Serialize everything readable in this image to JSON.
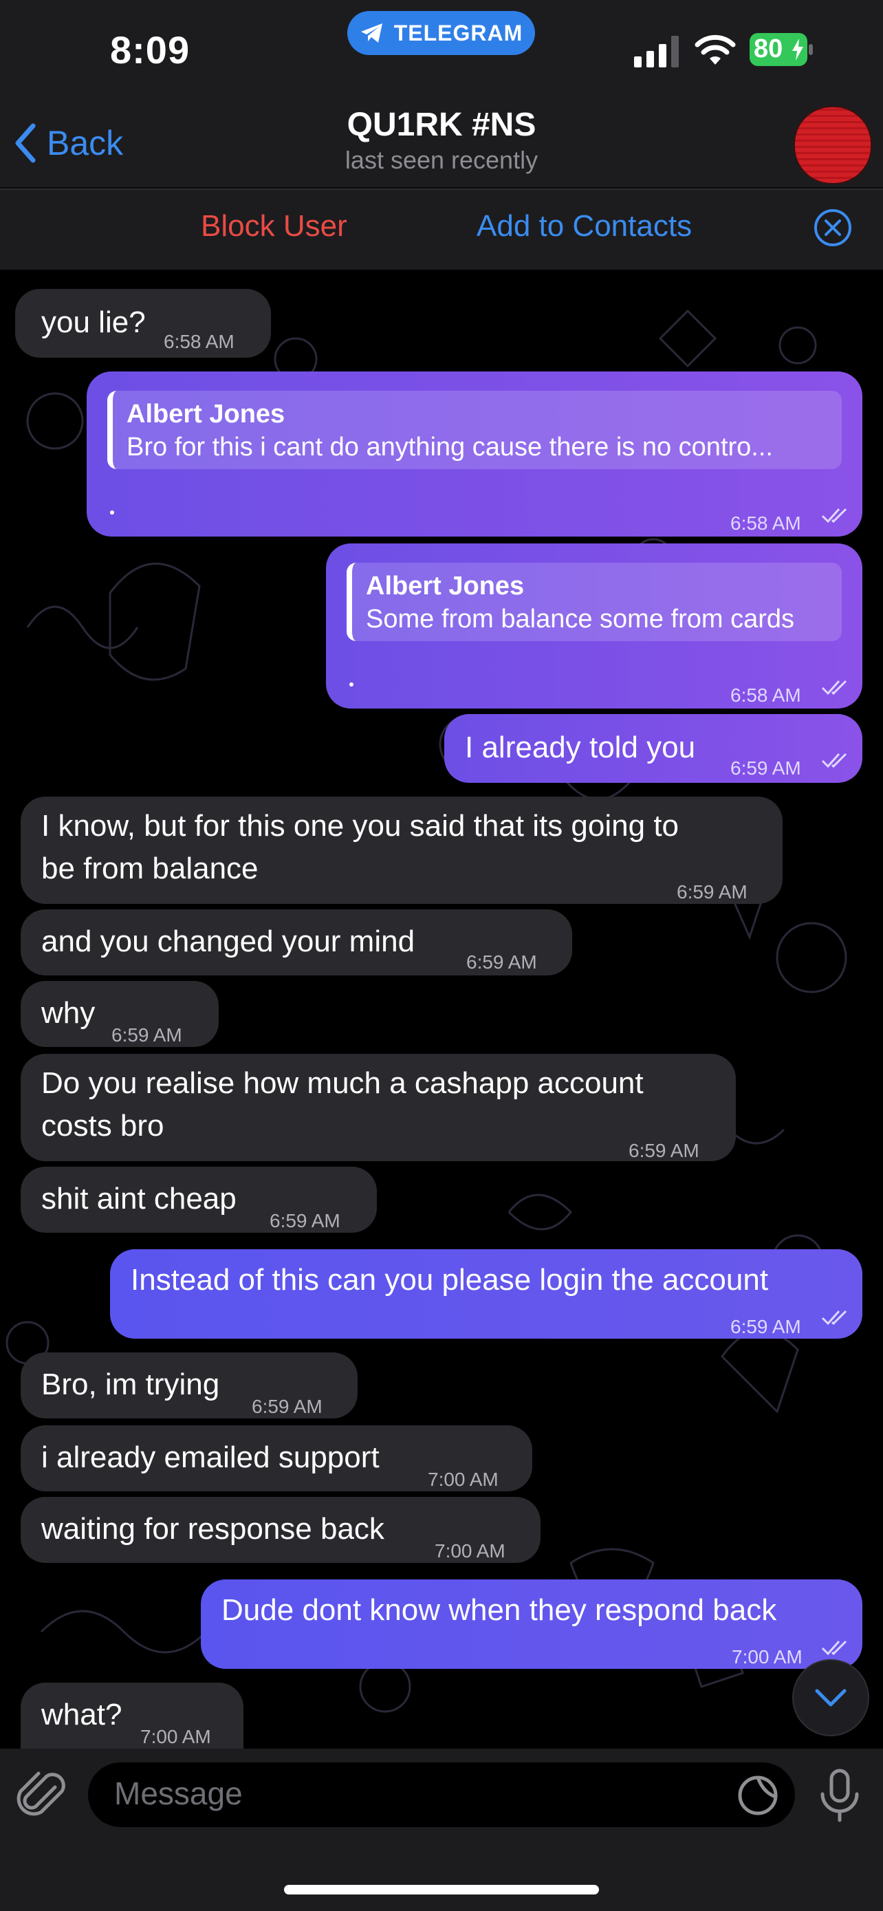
{
  "status": {
    "time": "8:09",
    "pill_label": "TELEGRAM",
    "battery": "80"
  },
  "header": {
    "back_label": "Back",
    "title": "QU1RK #NS",
    "subtitle": "last seen recently"
  },
  "banner": {
    "block_label": "Block User",
    "add_label": "Add to Contacts"
  },
  "messages": [
    {
      "dir": "in",
      "text": "you lie?",
      "time": "6:58 AM"
    },
    {
      "dir": "out",
      "reply_name": "Albert Jones",
      "reply_text": "Bro for this i cant do anything cause there is no contro...",
      "time": "6:58 AM"
    },
    {
      "dir": "out",
      "reply_name": "Albert Jones",
      "reply_text": "Some from balance some from cards",
      "time": "6:58 AM"
    },
    {
      "dir": "out",
      "text": "I already told you",
      "time": "6:59 AM"
    },
    {
      "dir": "in",
      "text_line1": "I know, but for this one you said that its going to",
      "text_line2": "be from balance",
      "time": "6:59 AM"
    },
    {
      "dir": "in",
      "text": "and you changed your mind",
      "time": "6:59 AM"
    },
    {
      "dir": "in",
      "text": "why",
      "time": "6:59 AM"
    },
    {
      "dir": "in",
      "text_line1": "Do you realise how much a cashapp account",
      "text_line2": "costs bro",
      "time": "6:59 AM"
    },
    {
      "dir": "in",
      "text": "shit aint cheap",
      "time": "6:59 AM"
    },
    {
      "dir": "out",
      "text": "Instead of this can you please login the account",
      "time": "6:59 AM"
    },
    {
      "dir": "in",
      "text": "Bro, im trying",
      "time": "6:59 AM"
    },
    {
      "dir": "in",
      "text": "i already emailed support",
      "time": "7:00 AM"
    },
    {
      "dir": "in",
      "text": "waiting for response back",
      "time": "7:00 AM"
    },
    {
      "dir": "out",
      "text": "Dude dont know when they respond back",
      "time": "7:00 AM"
    },
    {
      "dir": "in",
      "text": "what?",
      "time": "7:00 AM"
    }
  ],
  "composer": {
    "placeholder": "Message"
  }
}
